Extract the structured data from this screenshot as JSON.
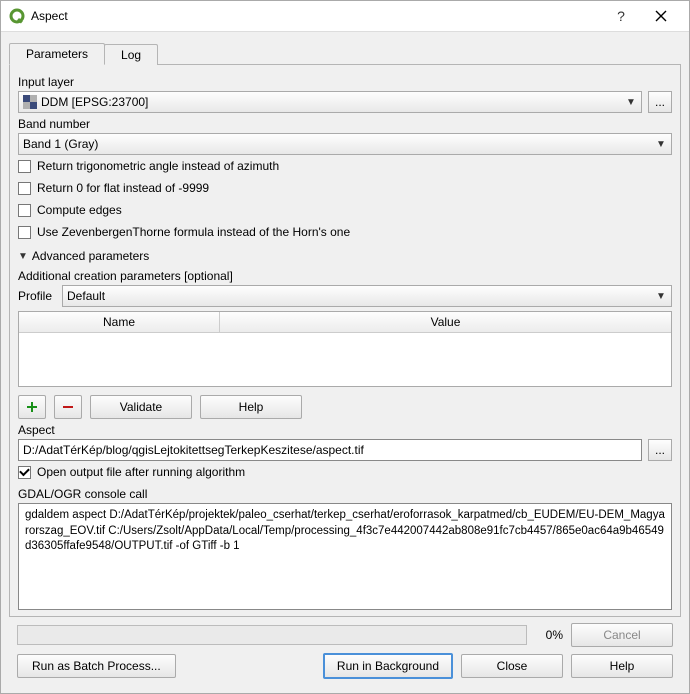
{
  "window": {
    "title": "Aspect"
  },
  "tabs": {
    "parameters": "Parameters",
    "log": "Log"
  },
  "labels": {
    "input_layer": "Input layer",
    "band_number": "Band number",
    "additional_params": "Additional creation parameters [optional]",
    "profile": "Profile",
    "aspect": "Aspect",
    "console": "GDAL/OGR console call",
    "advanced": "Advanced parameters"
  },
  "values": {
    "input_layer": "DDM [EPSG:23700]",
    "band_number": "Band 1 (Gray)",
    "profile": "Default",
    "aspect_path": "D:/AdatTérKép/blog/qgisLejtokitettsegTerkepKeszitese/aspect.tif",
    "console_text": "gdaldem aspect D:/AdatTérKép/projektek/paleo_cserhat/terkep_cserhat/eroforrasok_karpatmed/cb_EUDEM/EU-DEM_Magyarorszag_EOV.tif C:/Users/Zsolt/AppData/Local/Temp/processing_4f3c7e442007442ab808e91fc7cb4457/865e0ac64a9b46549d36305ffafe9548/OUTPUT.tif -of GTiff -b 1"
  },
  "checks": {
    "trig": "Return trigonometric angle instead of azimuth",
    "zero": "Return 0 for flat instead of -9999",
    "edges": "Compute edges",
    "zeven": "Use ZevenbergenThorne formula instead of the Horn's one",
    "open_output": "Open output file after running algorithm"
  },
  "table": {
    "name": "Name",
    "value": "Value"
  },
  "buttons": {
    "validate": "Validate",
    "help": "Help",
    "browse": "...",
    "cancel": "Cancel",
    "batch": "Run as Batch Process...",
    "run_bg": "Run in Background",
    "close": "Close",
    "help2": "Help",
    "plus": "✚",
    "minus": "━",
    "dropdown": "▼"
  },
  "progress": {
    "pct": "0%"
  }
}
